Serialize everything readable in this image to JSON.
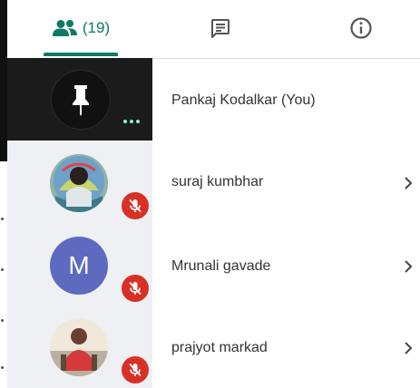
{
  "tabs": {
    "people_count": "(19)",
    "people_icon": "people-icon",
    "chat_icon": "chat-icon",
    "info_icon": "info-icon"
  },
  "participants": [
    {
      "name": "Pankaj Kodalkar (You)",
      "avatar": "pin-icon",
      "muted": false
    },
    {
      "name": "suraj kumbhar",
      "avatar": "photo",
      "muted": true
    },
    {
      "name": "Mrunali gavade",
      "avatar_letter": "M",
      "muted": true
    },
    {
      "name": "prajyot markad",
      "avatar": "photo",
      "muted": true
    }
  ],
  "colors": {
    "accent": "#0e7a66",
    "mute_badge": "#d93025",
    "avatar_m": "#5c6bc0"
  }
}
